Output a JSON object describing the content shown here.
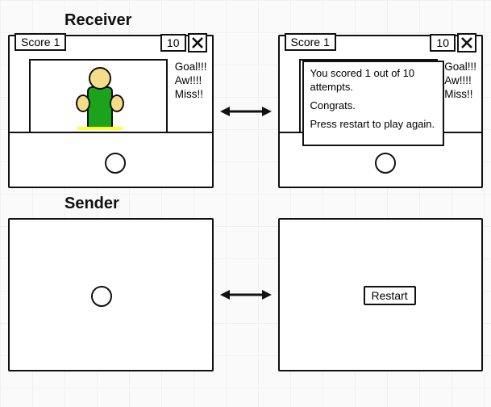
{
  "sections": {
    "receiver_title": "Receiver",
    "sender_title": "Sender"
  },
  "receiver": {
    "score_label": "Score",
    "score_value": "1",
    "attempts_value": "10",
    "feed": {
      "line1": "Goal!!!",
      "line2": "Aw!!!!",
      "line3": "Miss!!"
    },
    "modal": {
      "line1": "You scored 1 out of 10 attempts.",
      "line2": "Congrats.",
      "line3": "Press restart to play again."
    }
  },
  "sender": {
    "restart_label": "Restart"
  }
}
